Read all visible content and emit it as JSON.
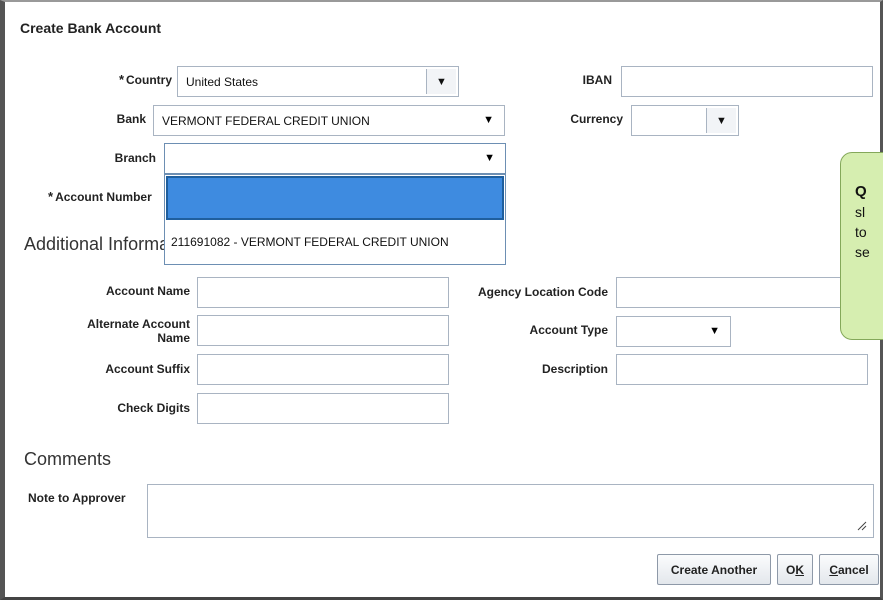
{
  "dialog": {
    "title": "Create Bank Account"
  },
  "fields": {
    "country": {
      "label": "Country",
      "value": "United States"
    },
    "bank": {
      "label": "Bank",
      "value": "VERMONT FEDERAL CREDIT UNION"
    },
    "branch": {
      "label": "Branch",
      "value": ""
    },
    "account_number": {
      "label": "Account Number",
      "value": ""
    },
    "iban": {
      "label": "IBAN",
      "value": ""
    },
    "currency": {
      "label": "Currency",
      "value": ""
    }
  },
  "branch_dropdown": {
    "options": [
      "",
      "211691082 - VERMONT FEDERAL CREDIT UNION"
    ]
  },
  "additional_info": {
    "heading": "Additional Information",
    "account_name": {
      "label": "Account Name",
      "value": ""
    },
    "alternate_account_name": {
      "label_line1": "Alternate Account",
      "label_line2": "Name",
      "value": ""
    },
    "account_suffix": {
      "label": "Account Suffix",
      "value": ""
    },
    "check_digits": {
      "label": "Check Digits",
      "value": ""
    },
    "agency_location_code": {
      "label": "Agency Location Code",
      "value": ""
    },
    "account_type": {
      "label": "Account Type",
      "value": ""
    },
    "description": {
      "label": "Description",
      "value": ""
    }
  },
  "comments": {
    "heading": "Comments",
    "note_to_approver": {
      "label": "Note to Approver",
      "value": ""
    }
  },
  "callout": {
    "line1": "Q",
    "line2": "sl",
    "line3": "to",
    "line4": "se"
  },
  "buttons": {
    "create_another": "Create Another",
    "ok_letter1": "O",
    "ok_letter2": "K",
    "cancel_letter1": "C",
    "cancel_rest": "ancel"
  },
  "icons": {
    "dropdown": "caret-down-icon",
    "resize": "resize-grip-icon"
  }
}
